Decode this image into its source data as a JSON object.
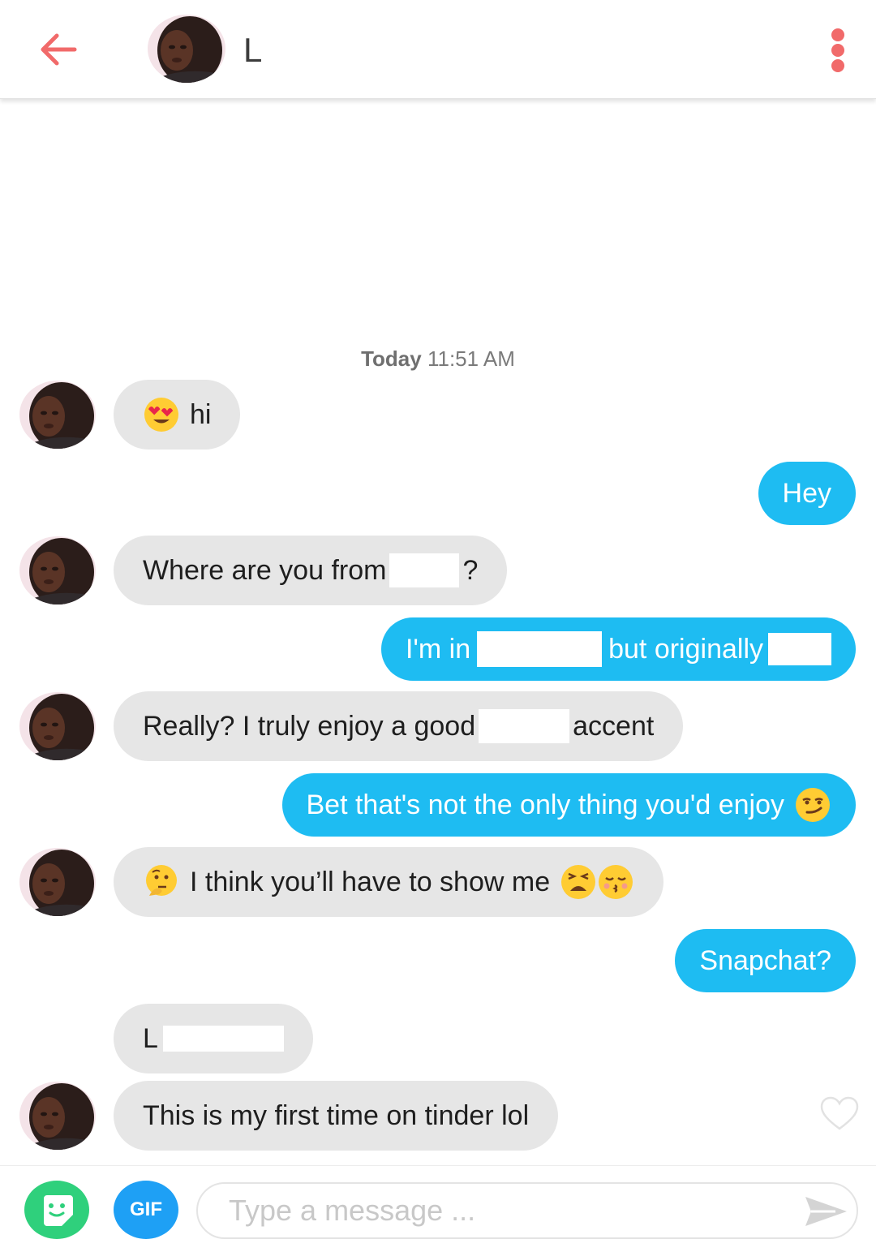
{
  "header": {
    "name": "L",
    "back_icon": "arrow-left-icon",
    "more_icon": "vertical-dots-icon",
    "accent_color": "#f16a6a"
  },
  "timestamp": {
    "day": "Today",
    "time": "11:51 AM"
  },
  "messages": [
    {
      "side": "in",
      "emoji": "heart-eyes-emoji",
      "text": "hi"
    },
    {
      "side": "out",
      "text": "Hey"
    },
    {
      "side": "in",
      "text": "Where are you from",
      "suffix": "?"
    },
    {
      "side": "out",
      "text": "I'm in",
      "middle": "but originally"
    },
    {
      "side": "in",
      "text": "Really? I truly enjoy a good",
      "suffix": "accent"
    },
    {
      "side": "out",
      "text": "Bet that's not the only thing you'd enjoy",
      "emoji": "smirk-emoji"
    },
    {
      "side": "in",
      "emoji": "thinking-emoji",
      "text": "I think you’ll have to show me",
      "emoji_end": [
        "weary-emoji",
        "kissing-emoji"
      ]
    },
    {
      "side": "out",
      "text": "Snapchat?"
    },
    {
      "side": "in",
      "text": "L"
    },
    {
      "side": "in",
      "text": "This is my first time on tinder lol"
    }
  ],
  "composer": {
    "gif_label": "GIF",
    "placeholder": "Type a message ...",
    "sticker_icon": "sticker-icon",
    "send_icon": "send-icon"
  },
  "colors": {
    "incoming_bubble": "#e6e6e6",
    "outgoing_bubble": "#1ebcf2",
    "sticker_button": "#2fd07c",
    "gif_button": "#1ea0f5"
  }
}
